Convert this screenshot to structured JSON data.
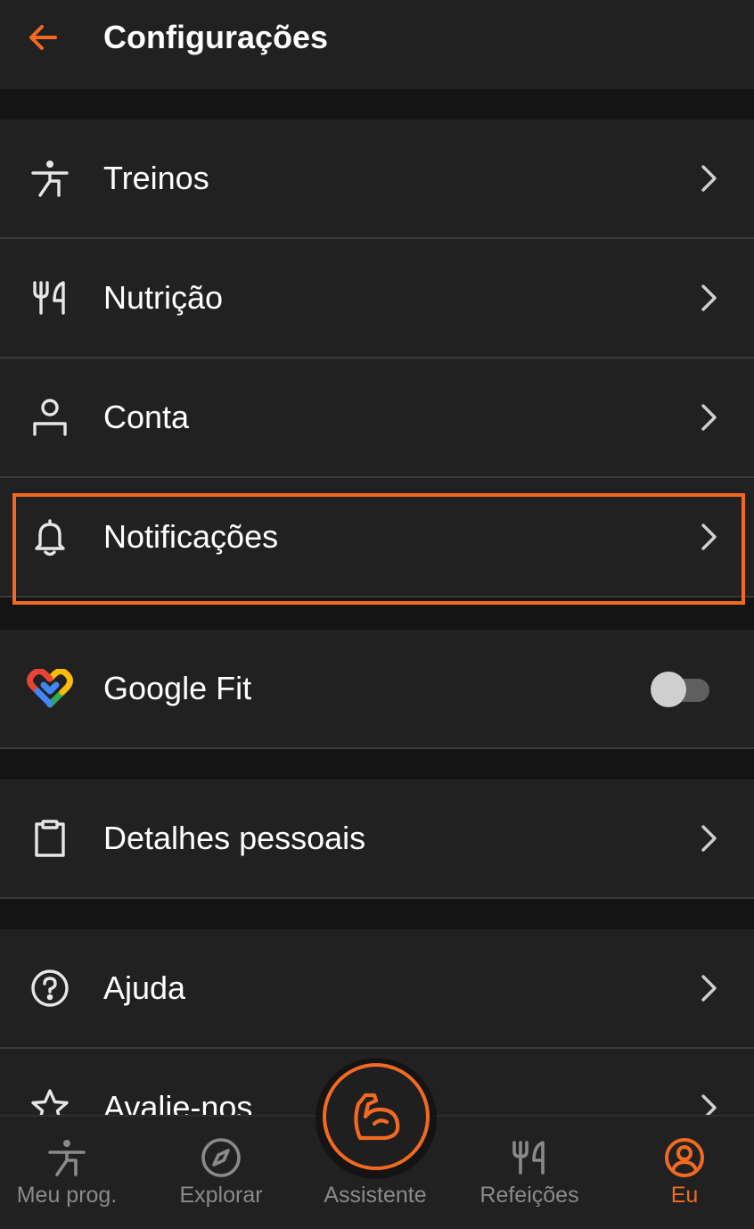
{
  "header": {
    "title": "Configurações",
    "back_icon": "arrow-left-icon"
  },
  "colors": {
    "accent": "#f26a22",
    "background": "#141414",
    "surface": "#212121",
    "divider": "#3a3a3a",
    "inactive": "#8a8a8a"
  },
  "settings": {
    "workouts": {
      "label": "Treinos",
      "icon": "stretching-person-icon"
    },
    "nutrition": {
      "label": "Nutrição",
      "icon": "fork-knife-icon"
    },
    "account": {
      "label": "Conta",
      "icon": "person-icon"
    },
    "notifications": {
      "label": "Notificações",
      "icon": "bell-icon",
      "highlighted": true
    },
    "google_fit": {
      "label": "Google Fit",
      "icon": "google-fit-icon",
      "toggle_on": false
    },
    "personal_details": {
      "label": "Detalhes pessoais",
      "icon": "clipboard-icon"
    },
    "help": {
      "label": "Ajuda",
      "icon": "help-circle-icon"
    },
    "rate_us": {
      "label": "Avalie-nos",
      "icon": "star-icon"
    }
  },
  "bottom_nav": {
    "program": {
      "label": "Meu prog.",
      "icon": "stretching-person-icon"
    },
    "explore": {
      "label": "Explorar",
      "icon": "compass-icon"
    },
    "assistant": {
      "label": "Assistente",
      "icon": "flexed-arm-icon"
    },
    "meals": {
      "label": "Refeições",
      "icon": "fork-knife-icon"
    },
    "me": {
      "label": "Eu",
      "icon": "profile-circle-icon",
      "active": true
    }
  }
}
